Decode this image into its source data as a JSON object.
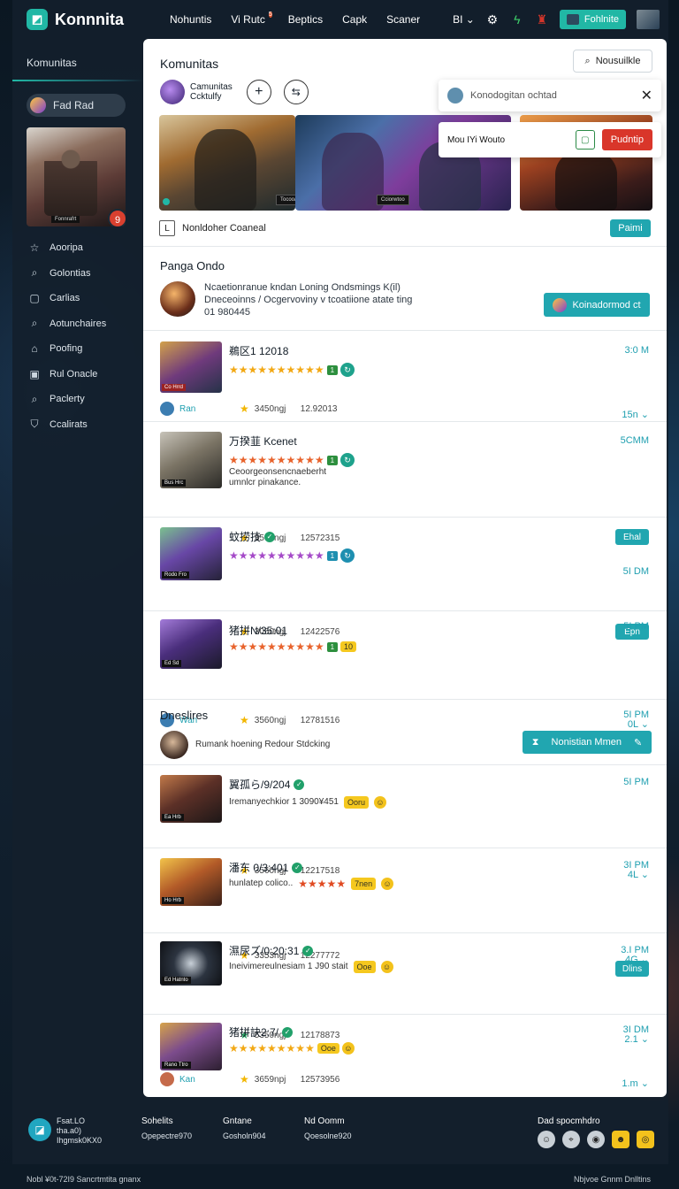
{
  "app": {
    "name": "Konnnita"
  },
  "topnav": [
    "Nohuntis",
    "Vi Rutc",
    "Beptics",
    "Capk",
    "Scaner"
  ],
  "topnav_badge": "5",
  "topright": {
    "lang": "BI",
    "profile_label": "Fohlnite"
  },
  "sidebar": {
    "title": "Komunitas",
    "user": "Fad Rad",
    "art_caption": "Fonnrafrt",
    "art_badge": "9",
    "items": [
      {
        "label": "Aooripa",
        "icon": "star-icon"
      },
      {
        "label": "Golontias",
        "icon": "search-icon"
      },
      {
        "label": "Carlias",
        "icon": "info-icon"
      },
      {
        "label": "Aotunchaires",
        "icon": "search-icon"
      },
      {
        "label": "Poofing",
        "icon": "home-icon"
      },
      {
        "label": "Rul Onacle",
        "icon": "grid-icon"
      },
      {
        "label": "Paclerty",
        "icon": "search-icon"
      },
      {
        "label": "Ccalirats",
        "icon": "shield-icon"
      }
    ]
  },
  "main": {
    "title": "Komunitas",
    "notify_button": "Nousuilkle",
    "community": {
      "line1": "Camunitas",
      "line2": "Ccktulfy"
    },
    "popup": {
      "text": "Konodogitan ochtad"
    },
    "popup2": {
      "text": "Mou IYi Wouto",
      "action": "Pudntip"
    },
    "hero_captions": [
      "Tocooaalog",
      "Cciorwtoo"
    ],
    "dropdown_label": "Nonldoher Coaneal",
    "dropdown_button": "Paimi",
    "section1": "Panga Ondo",
    "featured": {
      "line1": "Ncaetionranue kndan Loning  Ondsmings K(il)",
      "line2": "Dneceoinns / Ocgervoviny v tcoatiione atate ting",
      "line3": "01 980445",
      "button": "Koinadormod ct"
    },
    "section2": "Dneslires",
    "section2_row": {
      "text": "Rumank hoening Redour Stdcking",
      "button": "Nonistian Mmen"
    },
    "items": [
      {
        "title": "鵜区1 12018",
        "stars": "★★★★★★★★★★",
        "tag": "1",
        "user": "Ran",
        "stat": "3450ngj",
        "num": "12.92013",
        "time": "3:0 M",
        "count": "15n",
        "thumb_cap": "Co Hrrd"
      },
      {
        "title": "万揆韮 Kcenet",
        "sub": "Ceoorgeonsencnaeberht\numnlcr pinakance.",
        "stars": "★★★★★★★★★★",
        "tag": "1",
        "user": "Ran",
        "stat": "3560ngj",
        "num": "12572315",
        "time": "5CMM",
        "btn": "Ehal",
        "thumb_cap": "Bus Hrc"
      },
      {
        "title": "蚊捞技",
        "stars": "★★★★★★★★★★",
        "tag": "1",
        "user": "Wan",
        "stat": "3050ngj",
        "num": "12422576",
        "time": "5I DM",
        "btn": "Epn",
        "thumb_cap": "Rodo Fro"
      },
      {
        "title": "猪拼N/35:01",
        "stars": "★★★★★★★★★★",
        "tag": "1",
        "tag2": "10",
        "user": "Wan",
        "stat": "3560ngj",
        "num": "12781516",
        "time": "5I PM",
        "count": "0L",
        "thumb_cap": "Ed Sd"
      },
      {
        "title": "翼孤ら/9/204",
        "sub": "Iremanyechkior 1 3090¥451",
        "tagy": "Ooru",
        "user": "Wan",
        "stat": "3560ngj",
        "num": "12217518",
        "time": "5I PM",
        "count": "4L",
        "thumb_cap": "Ea Hrb"
      },
      {
        "title": "潘东 0/3:401",
        "sub": "hunlatep colico..",
        "stars5": "★★★★★",
        "tagy": "7nen",
        "user": "Kan",
        "stat": "3353ngj",
        "num": "12277772",
        "time": "3I PM",
        "count": "4G",
        "thumb_cap": "Ho Hrb"
      },
      {
        "title": "濕尿ズ/0:20:31",
        "sub": "Ineivimereulnesiam 1 J90 stait",
        "tagy": "Ooe",
        "user": "Nan",
        "stat": "5350ngj",
        "num": "12178873",
        "time": "3.I PM",
        "btn": "Dlins",
        "count": "2.1",
        "thumb_cap": "Ed Hatnto"
      },
      {
        "title": "猪拼訣2:7/",
        "stars": "★★★★★★★★★",
        "tagy": "Ooe",
        "user": "Kan",
        "stat": "3659npj",
        "num": "12573956",
        "time": "3I DM",
        "count": "1.m",
        "thumb_cap": "Rano Ttro"
      }
    ]
  },
  "footer": {
    "brand_l1": "Fsat.LO",
    "brand_l2": "tha.a0)",
    "brand_l3": "Ihgmsk0KX0",
    "col1_h": "Sohelits",
    "col1_t": "Opepectre970",
    "col2_h": "Gntane",
    "col2_t": "Gosholn904",
    "col3_h": "Nd Oomm",
    "col3_t": "Qoesolne920",
    "col4_h": "Dad spocmhdro"
  },
  "bottom": {
    "left": "Nobl  ¥0t-72I9 Sancrtmtita gnanx",
    "right": "Nbjvoe Gnnm Dnlltins"
  }
}
